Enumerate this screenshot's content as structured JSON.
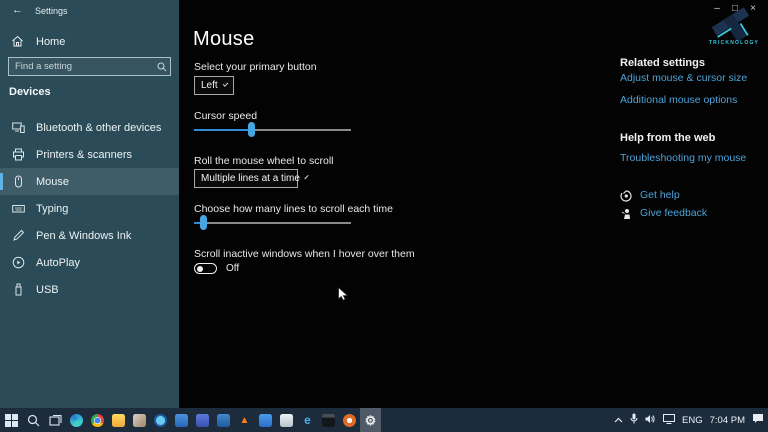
{
  "colors": {
    "sidebar_bg": "#2a4b57",
    "accent": "#5fb2e6",
    "link": "#4da3d9",
    "slider_fill": "#2f8cd8",
    "slider_thumb": "#45a6e2",
    "taskbar_bg": "#1d2c3d",
    "main_bg": "#030303",
    "logo_cyan": "#38cbe4"
  },
  "titlebar": {
    "back_icon": "←",
    "title": "Settings",
    "minimize": "–",
    "maximize": "□",
    "close": "×"
  },
  "sidebar": {
    "home_label": "Home",
    "search_placeholder": "Find a setting",
    "section_label": "Devices",
    "items": [
      {
        "label": "Bluetooth & other devices",
        "selected": false
      },
      {
        "label": "Printers & scanners",
        "selected": false
      },
      {
        "label": "Mouse",
        "selected": true
      },
      {
        "label": "Typing",
        "selected": false
      },
      {
        "label": "Pen & Windows Ink",
        "selected": false
      },
      {
        "label": "AutoPlay",
        "selected": false
      },
      {
        "label": "USB",
        "selected": false
      }
    ]
  },
  "main": {
    "title": "Mouse",
    "primary_button_label": "Select your primary button",
    "primary_button_value": "Left",
    "cursor_speed_label": "Cursor speed",
    "cursor_speed_percent": 36,
    "wheel_label": "Roll the mouse wheel to scroll",
    "wheel_value": "Multiple lines at a time",
    "lines_label": "Choose how many lines to scroll each time",
    "lines_percent": 6,
    "inactive_label": "Scroll inactive windows when I hover over them",
    "inactive_state": "Off"
  },
  "related": {
    "heading": "Related settings",
    "link_cursor_size": "Adjust mouse & cursor size",
    "link_mouse_options": "Additional mouse options",
    "help_heading": "Help from the web",
    "link_troubleshoot": "Troubleshooting my mouse",
    "get_help": "Get help",
    "give_feedback": "Give feedback"
  },
  "watermark": {
    "brand": "TRICKNOLOGY"
  },
  "taskbar": {
    "apps": [
      {
        "name": "edge",
        "shape": "circle",
        "bg": "conic-gradient(from 200deg,#45d6c2,#2b7cd4,#35c1d0,#45d6c2)"
      },
      {
        "name": "chrome",
        "shape": "circle",
        "bg": "radial-gradient(circle,#4285f4 0 31%,#ffffff 32% 38%,rgba(0,0,0,0) 39%),conic-gradient(#ea4335 0 33%,#fbbc05 0 66%,#34a853 0 100%)"
      },
      {
        "name": "file-explorer",
        "bg": "linear-gradient(180deg,#ffd95e,#f0a63c)"
      },
      {
        "name": "app-beige",
        "bg": "linear-gradient(135deg,#d9d0c5,#a08568)"
      },
      {
        "name": "skype",
        "shape": "circle",
        "bg": "radial-gradient(circle,#6cc7f2 0 48%,#1c5d9c 49%)"
      },
      {
        "name": "mail",
        "bg": "linear-gradient(180deg,#4a90e0,#2a66b8)"
      },
      {
        "name": "movies-tv",
        "bg": "linear-gradient(180deg,#5d79dc,#3b51ae)"
      },
      {
        "name": "powershell",
        "bg": "linear-gradient(180deg,#4488cc,#1e5a9a)"
      },
      {
        "name": "vlc",
        "glyph": "▲",
        "fg": "#ff8012",
        "bg": "transparent",
        "gs": 10
      },
      {
        "name": "photos",
        "bg": "linear-gradient(180deg,#4a9ae8,#2d6fc8)"
      },
      {
        "name": "notepad",
        "bg": "linear-gradient(180deg,#eef2f5,#b9c4cc)"
      },
      {
        "name": "internet-explorer",
        "glyph": "e",
        "fg": "#47b1ef",
        "bg": "transparent",
        "gs": 12
      },
      {
        "name": "cmd",
        "bg": "linear-gradient(180deg,#454d55 0 28%,#13171b 29%)"
      },
      {
        "name": "app-orange",
        "shape": "circle",
        "bg": "radial-gradient(circle,#f5f5f5 0 28%,#e06a26 29%)"
      },
      {
        "name": "settings-gear",
        "glyph": "⚙",
        "fg": "#eaeaea",
        "bg": "transparent",
        "gs": 13,
        "active": true
      }
    ],
    "tray": {
      "language": "ENG",
      "time": "7:04 PM"
    }
  }
}
